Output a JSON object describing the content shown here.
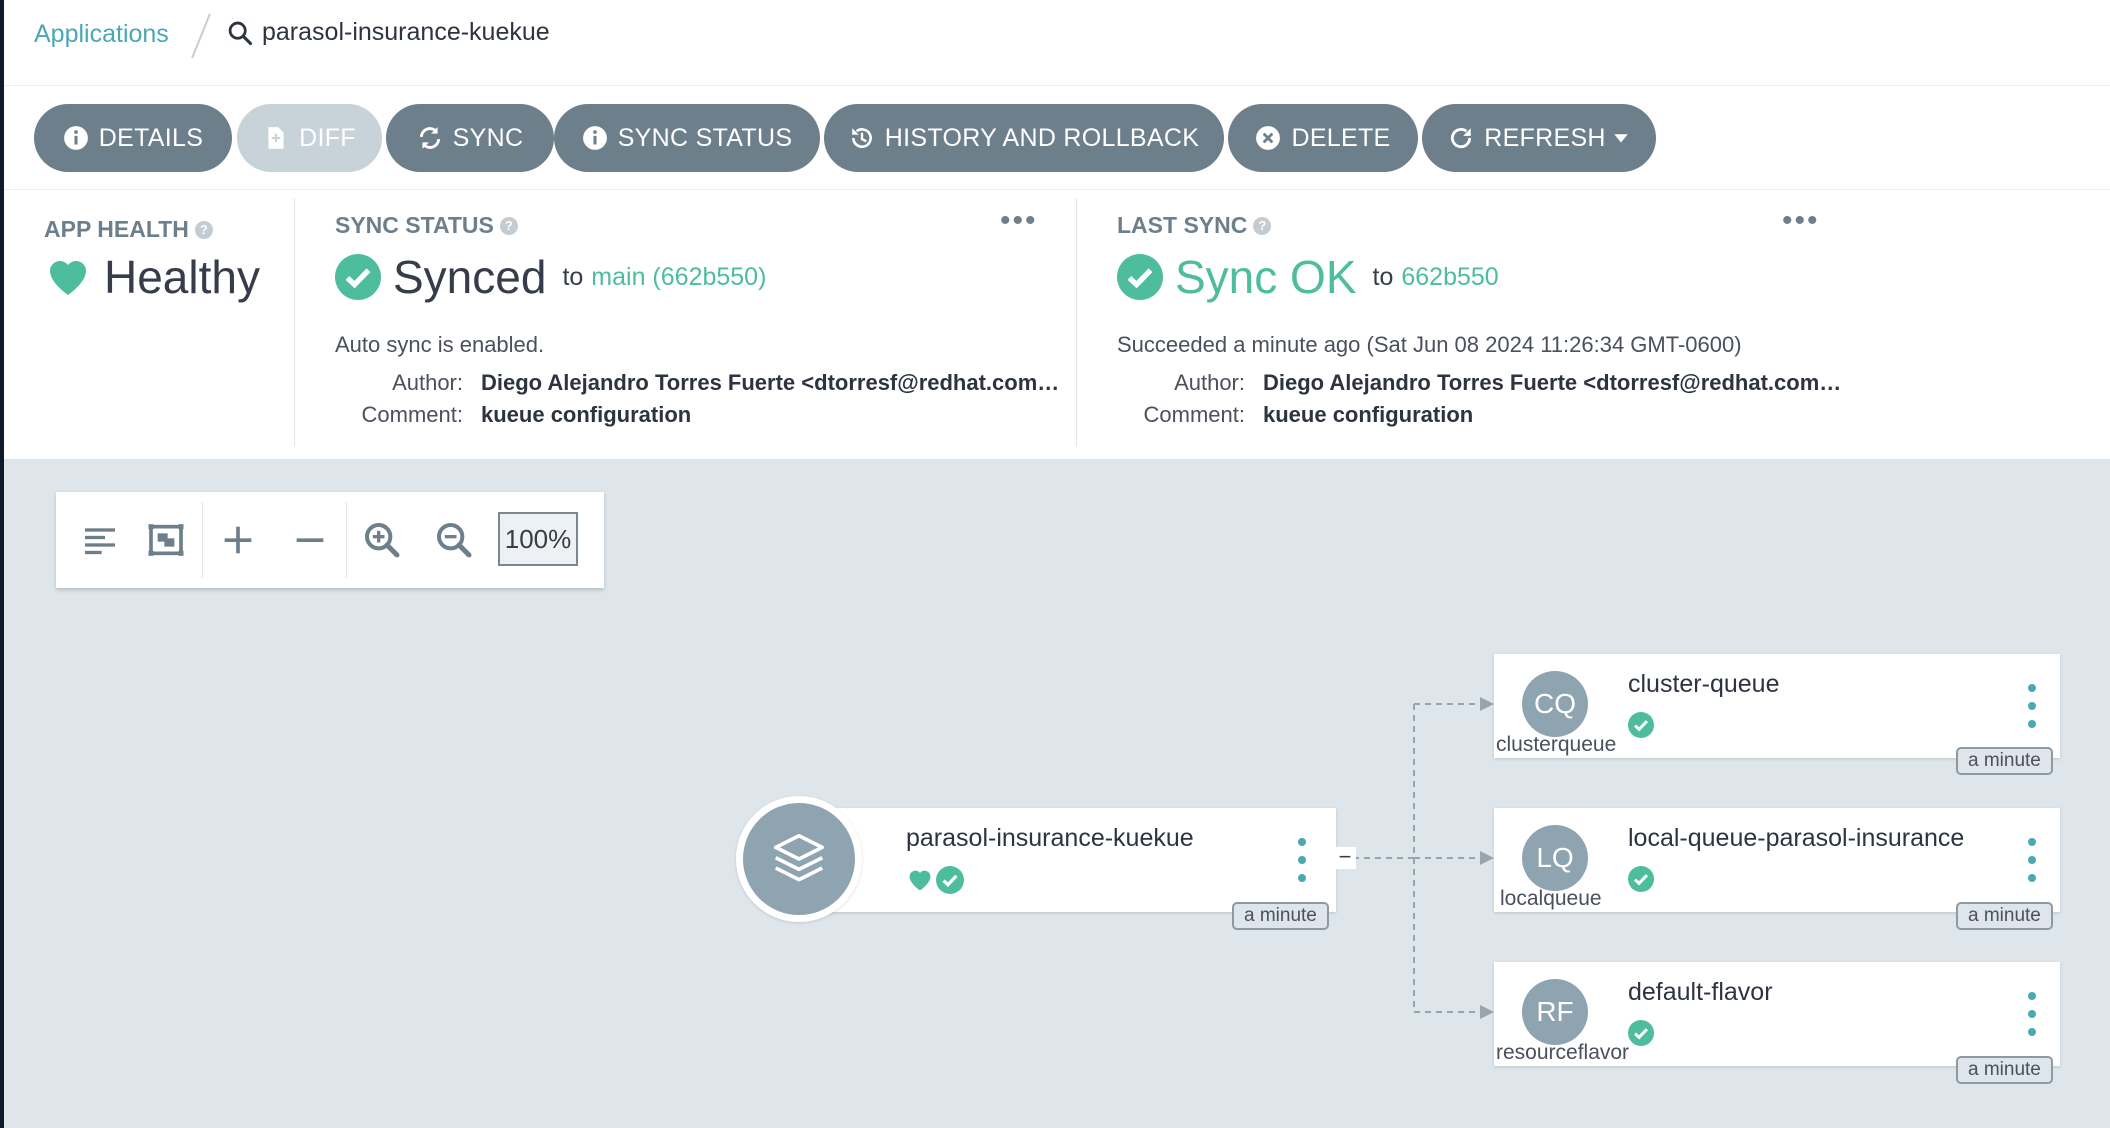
{
  "breadcrumb": {
    "root": "Applications",
    "current": "parasol-insurance-kuekue"
  },
  "toolbar": {
    "details": "DETAILS",
    "diff": "DIFF",
    "sync": "SYNC",
    "sync_status": "SYNC STATUS",
    "history": "HISTORY AND ROLLBACK",
    "delete": "DELETE",
    "refresh": "REFRESH"
  },
  "app_health": {
    "label": "APP HEALTH",
    "value": "Healthy"
  },
  "sync_status": {
    "label": "SYNC STATUS",
    "value": "Synced",
    "to": "to",
    "revision": "main (662b550)",
    "auto_sync": "Auto sync is enabled.",
    "author_label": "Author:",
    "author": "Diego Alejandro Torres Fuerte <dtorresf@redhat.com…",
    "comment_label": "Comment:",
    "comment": "kueue configuration"
  },
  "last_sync": {
    "label": "LAST SYNC",
    "value": "Sync OK",
    "to": "to",
    "revision": "662b550",
    "succeeded": "Succeeded a minute ago (Sat Jun 08 2024 11:26:34 GMT-0600)",
    "author_label": "Author:",
    "author": "Diego Alejandro Torres Fuerte <dtorresf@redhat.com…",
    "comment_label": "Comment:",
    "comment": "kueue configuration"
  },
  "zoom": {
    "level": "100%"
  },
  "graph": {
    "app": {
      "name": "parasol-insurance-kuekue",
      "age": "a minute"
    },
    "resources": [
      {
        "abbr": "CQ",
        "name": "cluster-queue",
        "kind": "clusterqueue",
        "age": "a minute"
      },
      {
        "abbr": "LQ",
        "name": "local-queue-parasol-insurance",
        "kind": "localqueue",
        "age": "a minute"
      },
      {
        "abbr": "RF",
        "name": "default-flavor",
        "kind": "resourceflavor",
        "age": "a minute"
      }
    ]
  },
  "colors": {
    "accent": "#4aa8b4",
    "healthy": "#4dbd9d",
    "button": "#6d7f8b",
    "canvas": "#dee6eb"
  }
}
